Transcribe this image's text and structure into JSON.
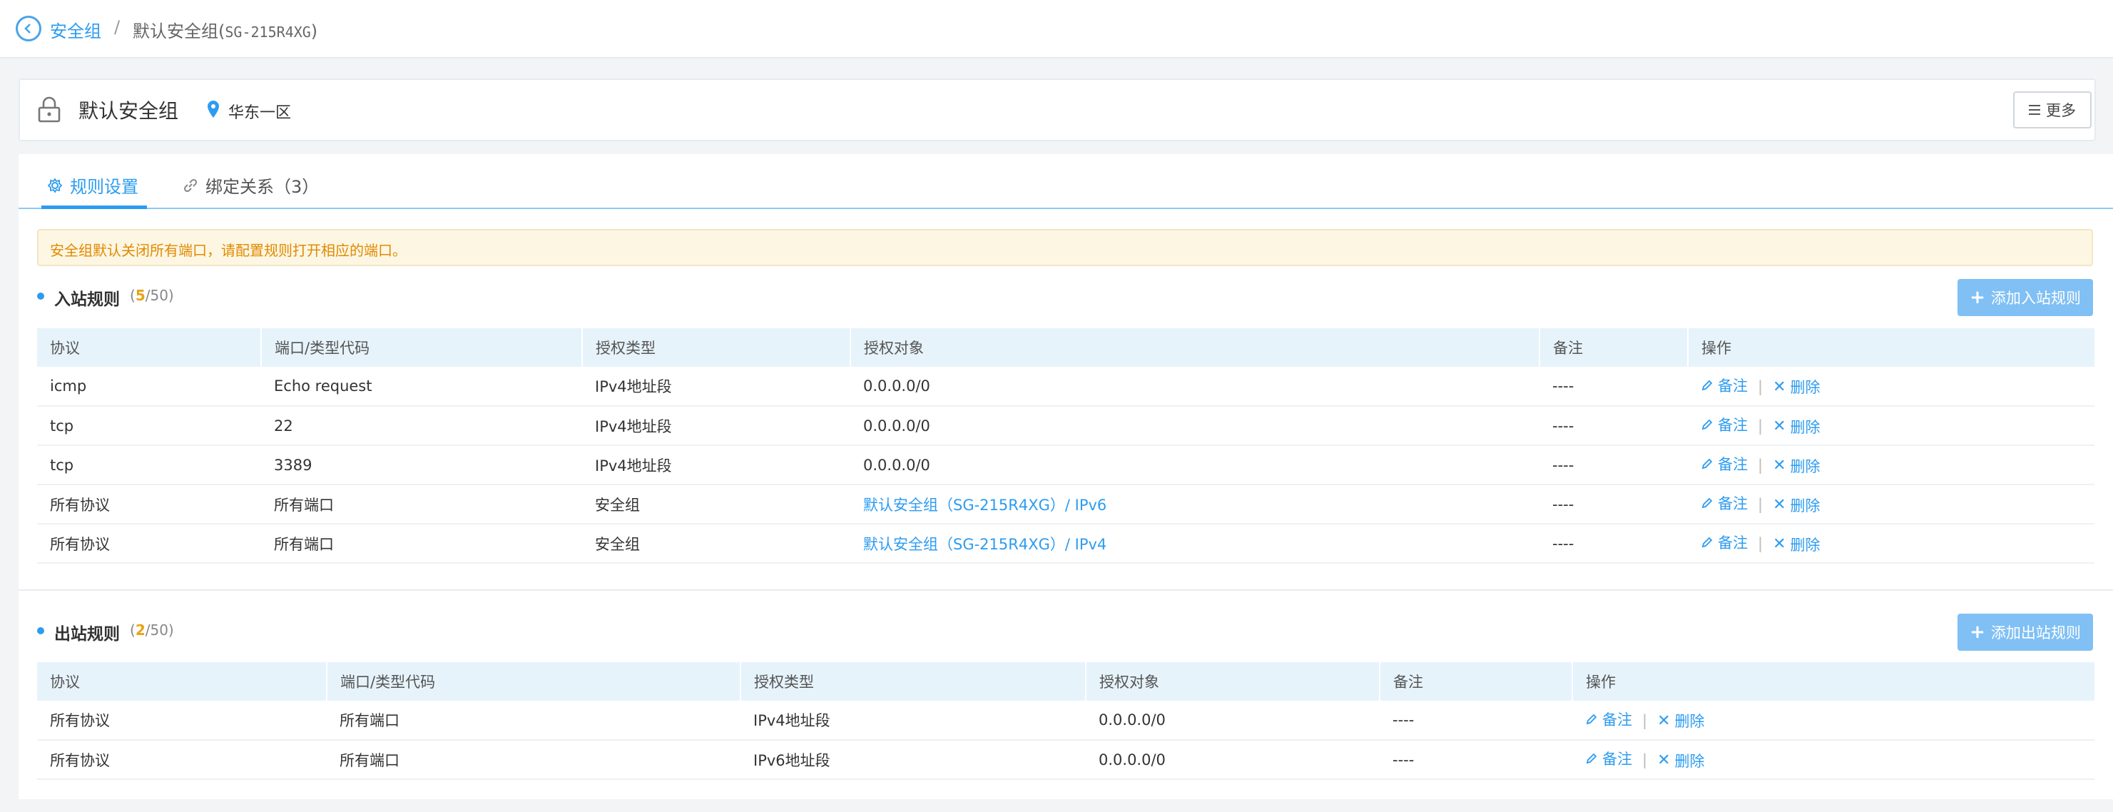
{
  "breadcrumb": {
    "parent": "安全组",
    "separator": "/",
    "current_prefix": "默认安全组(",
    "current_id": "SG-215R4XG",
    "current_suffix": ")"
  },
  "header": {
    "title": "默认安全组",
    "region": "华东一区",
    "more_label": "更多"
  },
  "tabs": [
    {
      "label": "规则设置"
    },
    {
      "label": "绑定关系（3）"
    }
  ],
  "notice": "安全组默认关闭所有端口，请配置规则打开相应的端口。",
  "inbound": {
    "title": "入站规则",
    "count_open": "(",
    "count_current": "5",
    "count_max": "/50)",
    "add_label": "添加入站规则",
    "columns": [
      "协议",
      "端口/类型代码",
      "授权类型",
      "授权对象",
      "备注",
      "操作"
    ],
    "rows": [
      {
        "protocol": "icmp",
        "port": "Echo request",
        "auth_type": "IPv4地址段",
        "auth_target": "0.0.0.0/0",
        "note": "----"
      },
      {
        "protocol": "tcp",
        "port": "22",
        "auth_type": "IPv4地址段",
        "auth_target": "0.0.0.0/0",
        "note": "----"
      },
      {
        "protocol": "tcp",
        "port": "3389",
        "auth_type": "IPv4地址段",
        "auth_target": "0.0.0.0/0",
        "note": "----"
      },
      {
        "protocol": "所有协议",
        "port": "所有端口",
        "auth_type": "安全组",
        "auth_target": "默认安全组（SG-215R4XG）/ IPv6",
        "note": "----"
      },
      {
        "protocol": "所有协议",
        "port": "所有端口",
        "auth_type": "安全组",
        "auth_target": "默认安全组（SG-215R4XG）/ IPv4",
        "note": "----"
      }
    ]
  },
  "outbound": {
    "title": "出站规则",
    "count_open": "(",
    "count_current": "2",
    "count_max": "/50)",
    "add_label": "添加出站规则",
    "columns": [
      "协议",
      "端口/类型代码",
      "授权类型",
      "授权对象",
      "备注",
      "操作"
    ],
    "rows": [
      {
        "protocol": "所有协议",
        "port": "所有端口",
        "auth_type": "IPv4地址段",
        "auth_target": "0.0.0.0/0",
        "note": "----"
      },
      {
        "protocol": "所有协议",
        "port": "所有端口",
        "auth_type": "IPv6地址段",
        "auth_target": "0.0.0.0/0",
        "note": "----"
      }
    ]
  },
  "row_actions": {
    "remark": "备注",
    "delete": "删除",
    "separator": "|"
  },
  "colors": {
    "accent": "#2d9cf0",
    "count_highlight": "#e8a317",
    "notice_text": "#e08a00"
  },
  "icons": [
    "back-circle-icon",
    "lock-icon",
    "location-pin-icon",
    "menu-lines-icon",
    "gear-icon",
    "link-icon",
    "plus-icon",
    "edit-pencil-icon",
    "close-x-icon"
  ]
}
